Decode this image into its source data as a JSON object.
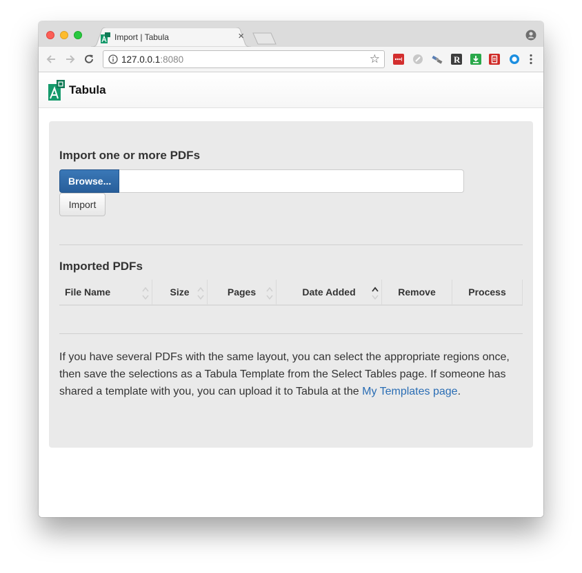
{
  "browser": {
    "tab_title": "Import | Tabula",
    "tab_close_glyph": "×",
    "url_host": "127.0.0.1",
    "url_port": ":8080",
    "star_glyph": "☆",
    "extension_icons": [
      "lastpass-icon",
      "gray-circle-icon",
      "satellite-icon",
      "r-icon",
      "download-icon",
      "pdf-red-icon",
      "blue-circle-icon"
    ]
  },
  "app": {
    "name": "Tabula"
  },
  "import_section": {
    "heading": "Import one or more PDFs",
    "browse_label": "Browse...",
    "import_label": "Import"
  },
  "imported_section": {
    "heading": "Imported PDFs",
    "columns": [
      "File Name",
      "Size",
      "Pages",
      "Date Added",
      "Remove",
      "Process"
    ]
  },
  "help": {
    "text": "If you have several PDFs with the same layout, you can select the appropriate regions once, then save the selections as a Tabula Template from the Select Tables page. If someone has shared a template with you, you can upload it to Tabula at the ",
    "link_text": "My Templates page",
    "suffix": "."
  },
  "colors": {
    "accent_blue": "#2a6db4",
    "browse_button": "#2f6aa8",
    "logo_green": "#159a6b",
    "well_bg": "#eaeaea"
  }
}
